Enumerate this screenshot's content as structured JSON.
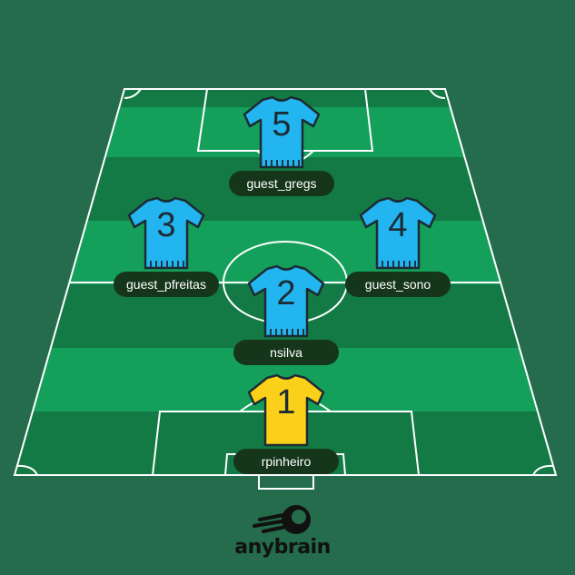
{
  "formation": {
    "players": [
      {
        "number": "5",
        "name": "guest_gregs",
        "role": "field",
        "shirt_color": "#22b5f0"
      },
      {
        "number": "3",
        "name": "guest_pfreitas",
        "role": "field",
        "shirt_color": "#22b5f0"
      },
      {
        "number": "4",
        "name": "guest_sono",
        "role": "field",
        "shirt_color": "#22b5f0"
      },
      {
        "number": "2",
        "name": "nsilva",
        "role": "field",
        "shirt_color": "#22b5f0"
      },
      {
        "number": "1",
        "name": "rpinheiro",
        "role": "goalkeeper",
        "shirt_color": "#fbd01a"
      }
    ]
  },
  "brand": {
    "logo_text": "anybrain",
    "logo_icon": "rocket-ball-icon"
  },
  "colors": {
    "background": "#246c4c",
    "pitch_dark": "#137a45",
    "pitch_light": "#14a05a",
    "lines": "#ffffff",
    "name_badge": "#16361b"
  }
}
